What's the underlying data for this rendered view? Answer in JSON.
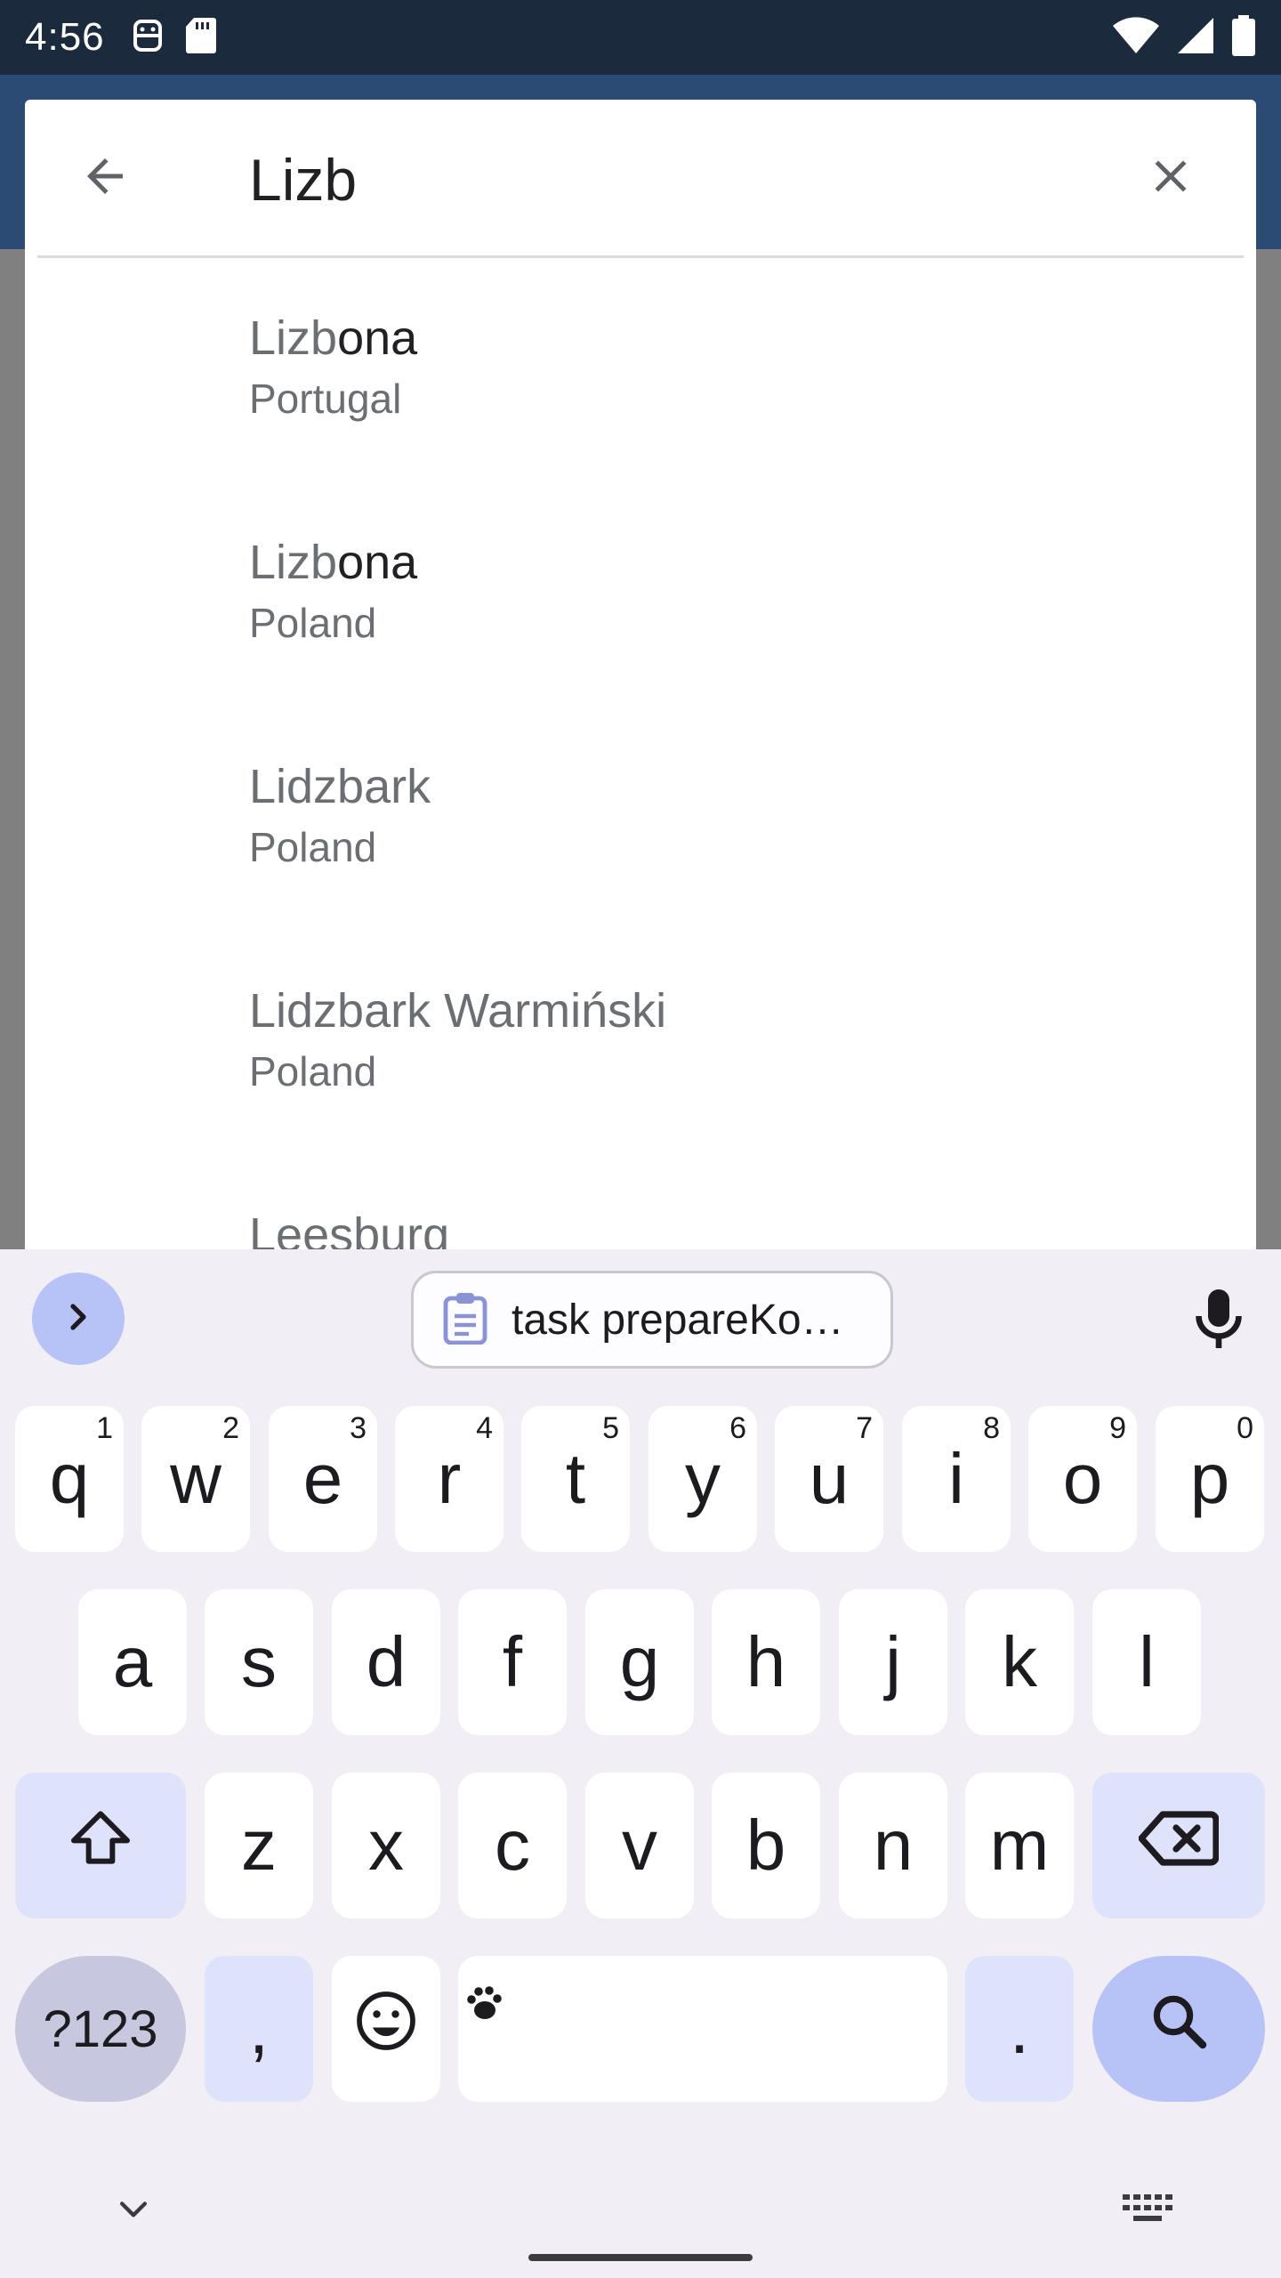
{
  "status_bar": {
    "time": "4:56",
    "icons_left": [
      "android-robot-icon",
      "sd-card-icon"
    ],
    "icons_right": [
      "wifi-icon",
      "cellular-signal-icon",
      "battery-icon"
    ]
  },
  "search": {
    "query": "Lizb",
    "back_icon": "arrow-back-icon",
    "clear_icon": "close-icon"
  },
  "results": [
    {
      "title_match": "Lizb",
      "title_rest": "ona",
      "subtitle": "Portugal"
    },
    {
      "title_match": "Lizb",
      "title_rest": "ona",
      "subtitle": "Poland"
    },
    {
      "title": "Lidzbark",
      "subtitle": "Poland"
    },
    {
      "title": "Lidzbark Warmiński",
      "subtitle": "Poland"
    },
    {
      "title": "Leesburg",
      "subtitle": ""
    }
  ],
  "keyboard": {
    "clipboard_suggestion": "task prepareKo…",
    "row1": [
      {
        "key": "q",
        "hint": "1"
      },
      {
        "key": "w",
        "hint": "2"
      },
      {
        "key": "e",
        "hint": "3"
      },
      {
        "key": "r",
        "hint": "4"
      },
      {
        "key": "t",
        "hint": "5"
      },
      {
        "key": "y",
        "hint": "6"
      },
      {
        "key": "u",
        "hint": "7"
      },
      {
        "key": "i",
        "hint": "8"
      },
      {
        "key": "o",
        "hint": "9"
      },
      {
        "key": "p",
        "hint": "0"
      }
    ],
    "row2": [
      "a",
      "s",
      "d",
      "f",
      "g",
      "h",
      "j",
      "k",
      "l"
    ],
    "row3": [
      "z",
      "x",
      "c",
      "v",
      "b",
      "n",
      "m"
    ],
    "symbols_label": "?123",
    "comma_label": ",",
    "period_label": ".",
    "accent_color": "#b7c2f7",
    "modifier_color": "#dfe2fb"
  }
}
